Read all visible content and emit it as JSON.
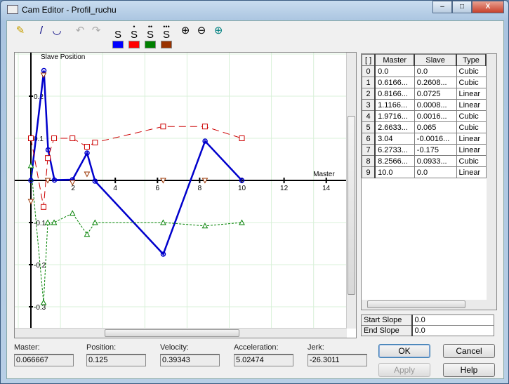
{
  "window": {
    "title": "Cam Editor - Profil_ruchu",
    "minimize": "–",
    "maximize": "□",
    "close": "X"
  },
  "toolbar": {
    "items": [
      {
        "name": "pencil-icon",
        "glyph": "✎",
        "color": "#c8a000"
      },
      {
        "name": "line-icon",
        "glyph": "/",
        "color": "#000080"
      },
      {
        "name": "curve-icon",
        "glyph": "◡",
        "color": "#000080"
      },
      {
        "name": "undo-icon",
        "glyph": "↶",
        "color": "#aaaaaa"
      },
      {
        "name": "redo-icon",
        "glyph": "↷",
        "color": "#aaaaaa"
      },
      {
        "name": "zoom-in-icon",
        "glyph": "⊕",
        "color": "#000"
      },
      {
        "name": "zoom-out-icon",
        "glyph": "⊖",
        "color": "#000"
      },
      {
        "name": "zoom-fit-icon",
        "glyph": "⊕",
        "color": "#008080"
      }
    ],
    "derivatives": [
      {
        "label": "S",
        "dots": "",
        "color": "#0000ff"
      },
      {
        "label": "S",
        "dots": "•",
        "color": "#ff0000"
      },
      {
        "label": "S",
        "dots": "••",
        "color": "#008000"
      },
      {
        "label": "S",
        "dots": "•••",
        "color": "#993300"
      }
    ]
  },
  "chart_data": {
    "type": "line",
    "xlabel": "Master",
    "ylabel": "Slave Position",
    "xticks": [
      2,
      4,
      6,
      8,
      10,
      12,
      14
    ],
    "yticks": [
      0.2,
      0.1,
      -0.1,
      -0.2,
      -0.3
    ],
    "xlim": [
      -0.7,
      15
    ],
    "ylim": [
      -0.34,
      0.3
    ],
    "grid": true,
    "series": [
      {
        "kind": "position",
        "color": "#0000cc",
        "points": [
          [
            0,
            0
          ],
          [
            0.6166,
            0.2608
          ],
          [
            0.8166,
            0.0725
          ],
          [
            1.1166,
            0.0008
          ],
          [
            1.9716,
            0.0016
          ],
          [
            2.6633,
            0.065
          ],
          [
            3.04,
            -0.0016
          ],
          [
            6.2733,
            -0.175
          ],
          [
            8.2566,
            0.0933
          ],
          [
            10,
            0
          ]
        ]
      },
      {
        "kind": "velocity",
        "color": "#cc0000",
        "points": [
          [
            0,
            0.1
          ],
          [
            0.6,
            -0.063
          ],
          [
            0.8,
            0.053
          ],
          [
            1.1,
            0.1
          ],
          [
            1.97,
            0.1
          ],
          [
            2.66,
            0.08
          ],
          [
            3.04,
            0.09
          ],
          [
            6.27,
            0.128
          ],
          [
            8.25,
            0.128
          ],
          [
            10,
            0.1
          ]
        ]
      },
      {
        "kind": "acceleration",
        "color": "#008000",
        "points": [
          [
            0,
            0.035
          ],
          [
            0.6,
            -0.29
          ],
          [
            0.8,
            -0.1
          ],
          [
            1.1,
            -0.1
          ],
          [
            1.97,
            -0.078
          ],
          [
            2.66,
            -0.128
          ],
          [
            3.04,
            -0.1
          ],
          [
            6.27,
            -0.1
          ],
          [
            8.25,
            -0.108
          ],
          [
            10,
            -0.1
          ]
        ]
      },
      {
        "kind": "jerk",
        "color": "#993300",
        "points": [
          [
            0,
            -0.05
          ],
          [
            0.6,
            0.25
          ],
          [
            0.8,
            0
          ],
          [
            1.97,
            -0.005
          ],
          [
            2.66,
            0.015
          ],
          [
            6.27,
            0
          ],
          [
            8.25,
            0
          ]
        ]
      }
    ]
  },
  "table": {
    "headers": [
      "[ ]",
      "Master",
      "Slave",
      "Type"
    ],
    "rows": [
      [
        "0",
        "0.0",
        "0.0",
        "Cubic"
      ],
      [
        "1",
        "0.6166...",
        "0.2608...",
        "Cubic"
      ],
      [
        "2",
        "0.8166...",
        "0.0725",
        "Linear"
      ],
      [
        "3",
        "1.1166...",
        "0.0008...",
        "Linear"
      ],
      [
        "4",
        "1.9716...",
        "0.0016...",
        "Cubic"
      ],
      [
        "5",
        "2.6633...",
        "0.065",
        "Cubic"
      ],
      [
        "6",
        "3.04",
        "-0.0016...",
        "Linear"
      ],
      [
        "7",
        "6.2733...",
        "-0.175",
        "Linear"
      ],
      [
        "8",
        "8.2566...",
        "0.0933...",
        "Cubic"
      ],
      [
        "9",
        "10.0",
        "0.0",
        "Linear"
      ]
    ]
  },
  "slopes": {
    "start_label": "Start Slope",
    "start_value": "0.0",
    "end_label": "End Slope",
    "end_value": "0.0"
  },
  "readouts": [
    {
      "label": "Master:",
      "value": "0.066667"
    },
    {
      "label": "Position:",
      "value": "0.125"
    },
    {
      "label": "Velocity:",
      "value": "0.39343"
    },
    {
      "label": "Acceleration:",
      "value": "5.02474"
    },
    {
      "label": "Jerk:",
      "value": "-26.3011"
    }
  ],
  "buttons": {
    "ok": "OK",
    "cancel": "Cancel",
    "apply": "Apply",
    "help": "Help"
  }
}
